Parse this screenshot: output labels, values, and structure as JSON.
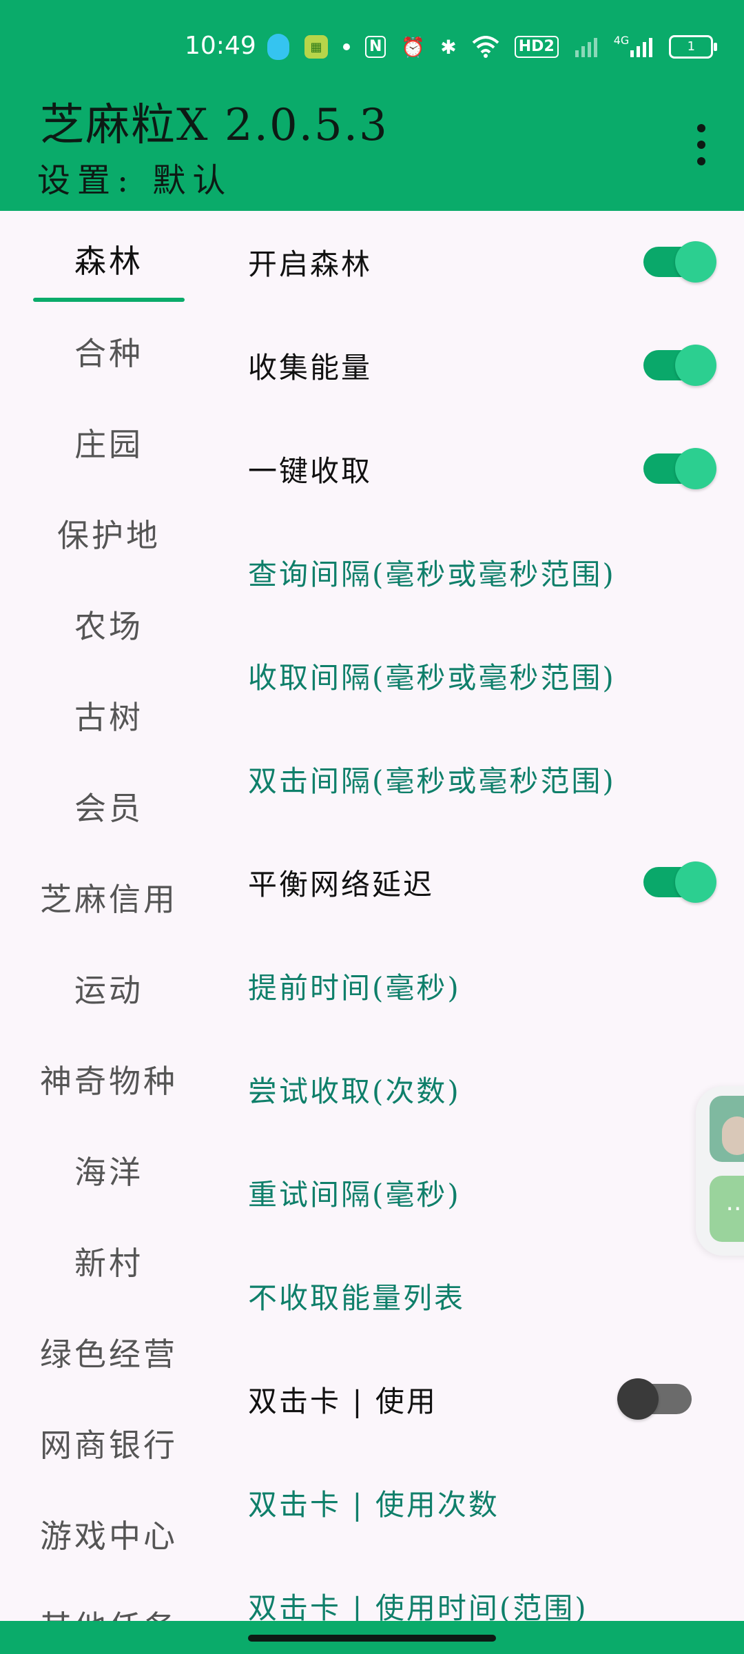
{
  "status_bar": {
    "time": "10:49",
    "battery": "1",
    "network": "4G",
    "hd": "HD2"
  },
  "header": {
    "title": "芝麻粒X 2.0.5.3",
    "subtitle": "设置: 默认"
  },
  "sidebar": {
    "items": [
      {
        "label": "森林",
        "active": true
      },
      {
        "label": "合种"
      },
      {
        "label": "庄园"
      },
      {
        "label": "保护地"
      },
      {
        "label": "农场"
      },
      {
        "label": "古树"
      },
      {
        "label": "会员"
      },
      {
        "label": "芝麻信用"
      },
      {
        "label": "运动"
      },
      {
        "label": "神奇物种"
      },
      {
        "label": "海洋"
      },
      {
        "label": "新村"
      },
      {
        "label": "绿色经营"
      },
      {
        "label": "网商银行"
      },
      {
        "label": "游戏中心"
      },
      {
        "label": "其他任务"
      }
    ]
  },
  "settings": {
    "rows": [
      {
        "label": "开启森林",
        "type": "switch",
        "on": true
      },
      {
        "label": "收集能量",
        "type": "switch",
        "on": true
      },
      {
        "label": "一键收取",
        "type": "switch",
        "on": true
      },
      {
        "label": "查询间隔(毫秒或毫秒范围)",
        "type": "link"
      },
      {
        "label": "收取间隔(毫秒或毫秒范围)",
        "type": "link"
      },
      {
        "label": "双击间隔(毫秒或毫秒范围)",
        "type": "link"
      },
      {
        "label": "平衡网络延迟",
        "type": "switch",
        "on": true
      },
      {
        "label": "提前时间(毫秒)",
        "type": "link"
      },
      {
        "label": "尝试收取(次数)",
        "type": "link"
      },
      {
        "label": "重试间隔(毫秒)",
        "type": "link"
      },
      {
        "label": "不收取能量列表",
        "type": "link"
      },
      {
        "label": "双击卡 | 使用",
        "type": "switch",
        "on": false
      },
      {
        "label": "双击卡 | 使用次数",
        "type": "link"
      },
      {
        "label": "双击卡 | 使用时间(范围)",
        "type": "link"
      }
    ]
  },
  "colors": {
    "primary": "#0aab6a",
    "link_text": "#0f7f6a",
    "background": "#fbf6fb"
  },
  "icons": [
    "qq-icon",
    "app-icon",
    "dot-icon",
    "nfc-icon",
    "alarm-icon",
    "bluetooth-icon",
    "wifi-icon",
    "hd-icon",
    "signal-icon",
    "battery-icon",
    "more-vert-icon"
  ]
}
